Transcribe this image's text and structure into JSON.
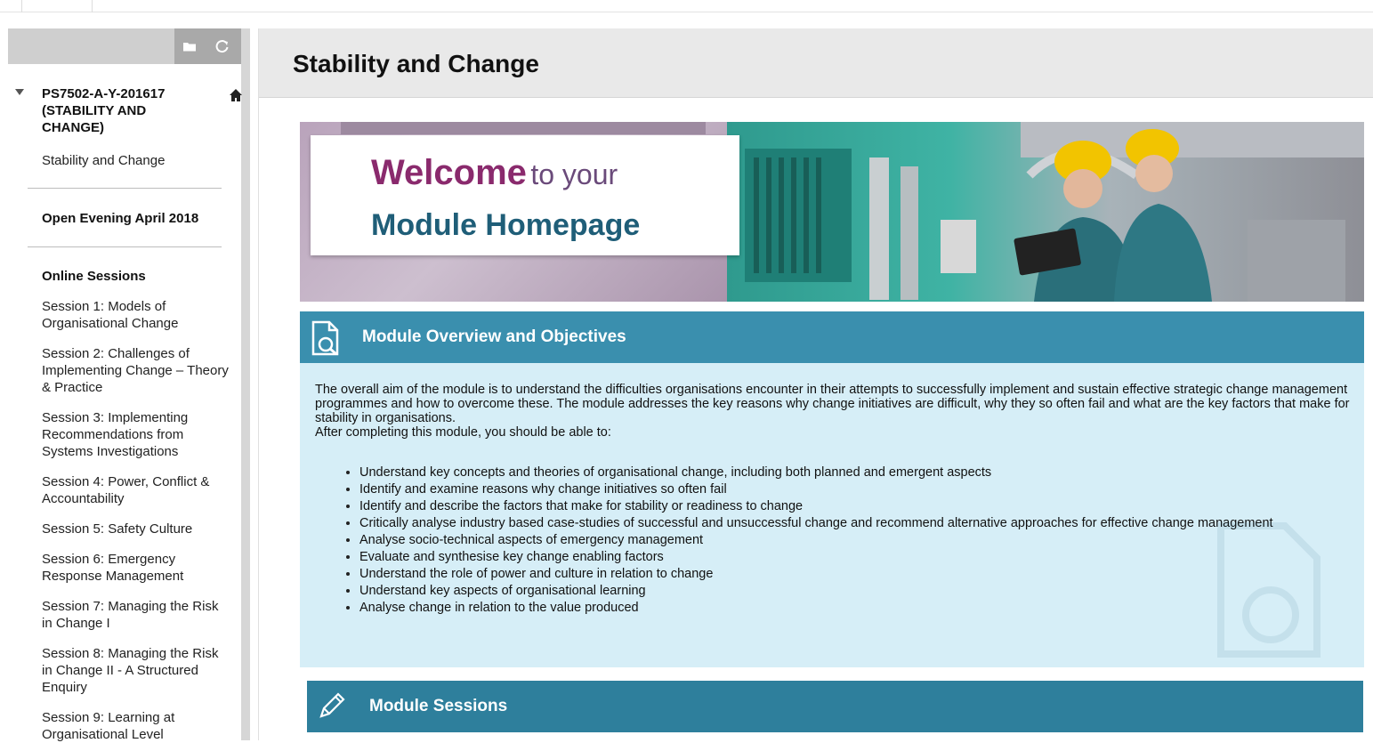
{
  "sidebar": {
    "course_title": "PS7502-A-Y-201617 (STABILITY AND CHANGE)",
    "items": [
      {
        "label": "Stability and Change"
      },
      {
        "label": "Open Evening April 2018"
      },
      {
        "label": "Online Sessions"
      },
      {
        "label": "Session 1: Models of Organisational Change"
      },
      {
        "label": "Session 2: Challenges of Implementing Change – Theory & Practice"
      },
      {
        "label": "Session 3: Implementing Recommendations from Systems Investigations"
      },
      {
        "label": "Session 4: Power, Conflict & Accountability"
      },
      {
        "label": "Session 5: Safety Culture"
      },
      {
        "label": "Session 6: Emergency Response Management"
      },
      {
        "label": "Session 7: Managing the Risk in Change I"
      },
      {
        "label": "Session 8: Managing the Risk in Change II - A Structured Enquiry"
      },
      {
        "label": "Session 9: Learning at Organisational Level"
      }
    ]
  },
  "main": {
    "page_title": "Stability and Change",
    "banner": {
      "welcome": "Welcome",
      "to_your": "to your",
      "module_homepage": "Module Homepage"
    },
    "overview": {
      "title": "Module Overview and Objectives",
      "paragraph": "The overall aim of the module is to understand the difficulties organisations encounter in their attempts to successfully implement and sustain effective strategic change management programmes and how to overcome these. The module addresses the key reasons why change initiatives are difficult, why they so often fail and what are the key factors that make for stability in organisations.",
      "lead_in": "After completing this module, you should be able to:",
      "objectives": [
        "Understand key concepts and theories of organisational change, including both planned and emergent aspects",
        "Identify and examine reasons why change initiatives so often fail",
        "Identify and describe the factors that make for stability or readiness to change",
        "Critically analyse industry based case-studies of successful and unsuccessful change and recommend alternative approaches for effective change management",
        "Analyse socio-technical aspects of emergency management",
        "Evaluate and synthesise key change enabling factors",
        "Understand the role of power and culture in relation to change",
        "Understand key aspects of organisational learning",
        "Analyse change in relation to the value produced"
      ]
    },
    "sessions": {
      "title": "Module Sessions"
    }
  },
  "icons": {
    "folder": "folder-icon",
    "refresh": "refresh-icon",
    "home": "home-icon",
    "document_search": "document-search-icon",
    "pencil": "pencil-icon"
  },
  "colors": {
    "panel_header": "#3a8fae",
    "panel_body": "#d6eef7",
    "sessions_header": "#2e7f9c",
    "welcome_purple": "#8a2a6d",
    "homepage_blue": "#1f5e78"
  }
}
